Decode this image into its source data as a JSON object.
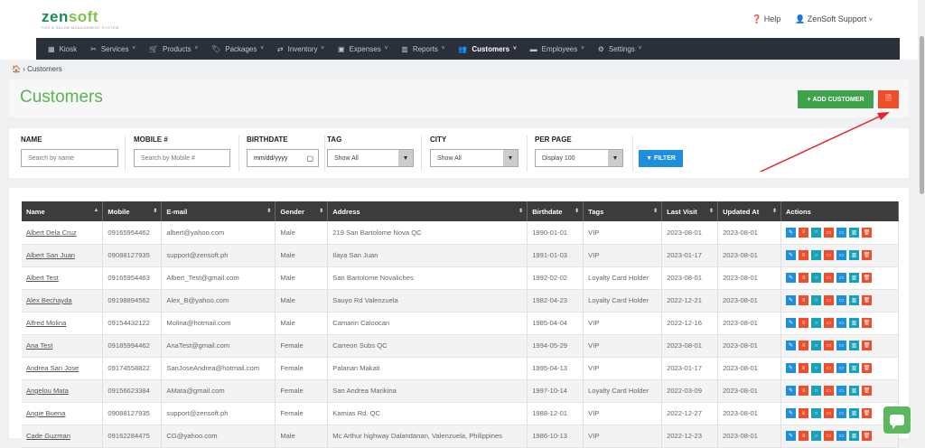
{
  "brand": {
    "name_a": "zen",
    "name_b": "soft",
    "tagline": "POS & SALON MANAGEMENT SYSTEM"
  },
  "top": {
    "help": "Help",
    "user": "ZenSoft Support"
  },
  "nav": [
    {
      "icon": "kiosk-icon",
      "glyph": "▦",
      "label": "Kiosk",
      "caret": false
    },
    {
      "icon": "services-icon",
      "glyph": "✂",
      "label": "Services",
      "caret": true
    },
    {
      "icon": "cart-icon",
      "glyph": "🛒",
      "label": "Products",
      "caret": true
    },
    {
      "icon": "tag-icon",
      "glyph": "🏷",
      "label": "Packages",
      "caret": true
    },
    {
      "icon": "inventory-icon",
      "glyph": "⇄",
      "label": "Inventory",
      "caret": true
    },
    {
      "icon": "expenses-icon",
      "glyph": "▣",
      "label": "Expenses",
      "caret": true
    },
    {
      "icon": "reports-icon",
      "glyph": "▥",
      "label": "Reports",
      "caret": true
    },
    {
      "icon": "customers-icon",
      "glyph": "👥",
      "label": "Customers",
      "caret": true,
      "active": true
    },
    {
      "icon": "employees-icon",
      "glyph": "▬",
      "label": "Employees",
      "caret": true
    },
    {
      "icon": "settings-icon",
      "glyph": "⚙",
      "label": "Settings",
      "caret": true
    }
  ],
  "breadcrumb": "Customers",
  "page_title": "Customers",
  "buttons": {
    "add": "ADD CUSTOMER",
    "filter": "FILTER"
  },
  "filters": {
    "name": {
      "label": "NAME",
      "placeholder": "Search by name"
    },
    "mobile": {
      "label": "MOBILE #",
      "placeholder": "Search by Mobile #"
    },
    "birthdate": {
      "label": "BIRTHDATE",
      "value": "mm/dd/yyyy"
    },
    "tag": {
      "label": "TAG",
      "value": "Show All"
    },
    "city": {
      "label": "CITY",
      "value": "Show All"
    },
    "perpage": {
      "label": "PER PAGE",
      "value": "Display 100"
    }
  },
  "table": {
    "columns": [
      "Name",
      "Mobile",
      "E-mail",
      "Gender",
      "Address",
      "Birthdate",
      "Tags",
      "Last Visit",
      "Updated At",
      "Actions"
    ],
    "rows": [
      [
        "Albert Dela Cruz",
        "09165954462",
        "albert@yahoo.com",
        "Male",
        "219 San Bartolome Nova QC",
        "1990-01-01",
        "VIP",
        "2023-08-01",
        "2023-08-01"
      ],
      [
        "Albert San Juan",
        "09088127935",
        "support@zensoft.ph",
        "Male",
        "Ilaya San Juan",
        "1991-01-03",
        "VIP",
        "2023-01-17",
        "2023-08-01"
      ],
      [
        "Albert Test",
        "09165954463",
        "Albert_Test@gmail.com",
        "Male",
        "San Bartolome Novaliches",
        "1992-02-02",
        "Loyalty Card Holder",
        "2023-08-01",
        "2023-08-01"
      ],
      [
        "Alex Bechayda",
        "09198894562",
        "Alex_B@yahoo.com",
        "Male",
        "Sauyo Rd Valenzuela",
        "1982-04-23",
        "Loyalty Card Holder",
        "2022-12-21",
        "2023-08-01"
      ],
      [
        "Alfred Molina",
        "09154432122",
        "Molina@hotmail.com",
        "Male",
        "Camarin Caloocan",
        "1985-04-04",
        "VIP",
        "2022-12-16",
        "2023-08-01"
      ],
      [
        "Ana Test",
        "09185994462",
        "AnaTest@gmail.com",
        "Female",
        "Carreon Subs QC",
        "1994-05-29",
        "VIP",
        "2023-08-01",
        "2023-08-01"
      ],
      [
        "Andrea San Jose",
        "09174558822",
        "SanJoseAndrea@hotmail.com",
        "Female",
        "Palanan Makati",
        "1995-04-13",
        "VIP",
        "2023-01-17",
        "2023-08-01"
      ],
      [
        "Angelou Mata",
        "09156623384",
        "AMata@gmail.com",
        "Female",
        "San Andrea Marikina",
        "1997-10-14",
        "Loyalty Card Holder",
        "2022-03-09",
        "2023-08-01"
      ],
      [
        "Angie Buena",
        "09088127935",
        "support@zensoft.ph",
        "Female",
        "Kamias Rd. QC",
        "1988-12-01",
        "VIP",
        "2022-12-27",
        "2023-08-01"
      ],
      [
        "Cade Guzman",
        "09162284475",
        "CG@yahoo.com",
        "Male",
        "Mc Arthur highway Dalandanan, Valenzuela, Philippines",
        "1986-10-13",
        "VIP",
        "2022-12-23",
        "2023-08-01"
      ]
    ]
  },
  "action_icons": [
    {
      "name": "edit-icon",
      "glyph": "✎",
      "color": "#1e8fdc"
    },
    {
      "name": "list-icon",
      "glyph": "≡",
      "color": "#f04e2b"
    },
    {
      "name": "circle-icon",
      "glyph": "○",
      "color": "#17a2b8"
    },
    {
      "name": "card-icon",
      "glyph": "▭",
      "color": "#f04e2b"
    },
    {
      "name": "card-alt-icon",
      "glyph": "▭",
      "color": "#1e8fdc"
    },
    {
      "name": "chart-icon",
      "glyph": "▥",
      "color": "#17a2b8"
    },
    {
      "name": "delete-icon",
      "glyph": "🗑",
      "color": "#f04e2b"
    }
  ]
}
